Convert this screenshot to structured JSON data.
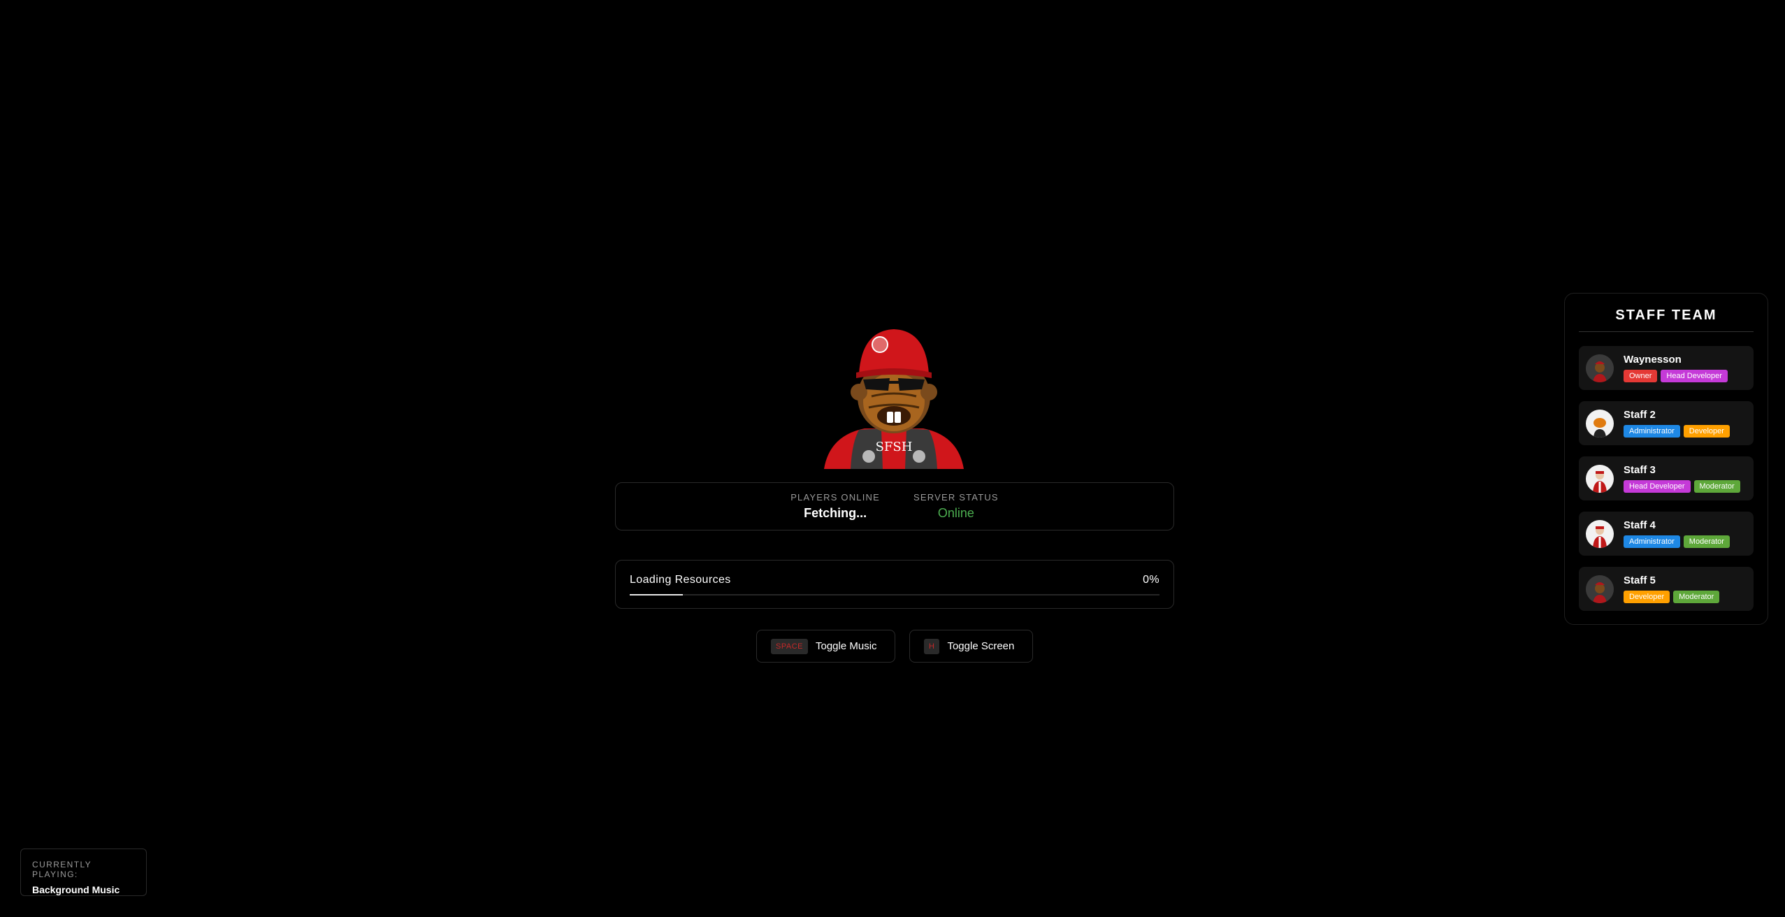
{
  "server": {
    "players_label": "PLAYERS ONLINE",
    "players_value": "Fetching...",
    "status_label": "SERVER STATUS",
    "status_value": "Online",
    "status_color": "#4caf50"
  },
  "logo": {
    "shirt_text": "SFSH",
    "description_icon": "beaver-character-logo"
  },
  "loading": {
    "label": "Loading Resources",
    "percent_text": "0%",
    "progress_fraction": 0.1
  },
  "controls": [
    {
      "key": "SPACE",
      "label": "Toggle Music"
    },
    {
      "key": "H",
      "label": "Toggle Screen"
    }
  ],
  "staff": {
    "title": "STAFF TEAM",
    "members": [
      {
        "name": "Waynesson",
        "avatar": "beaver-avatar",
        "badges": [
          {
            "text": "Owner",
            "color": "#e53935"
          },
          {
            "text": "Head Developer",
            "color": "#c53ad8"
          }
        ]
      },
      {
        "name": "Staff 2",
        "avatar": "pumpkin-avatar",
        "badges": [
          {
            "text": "Administrator",
            "color": "#1e88e5"
          },
          {
            "text": "Developer",
            "color": "#ffa000"
          }
        ]
      },
      {
        "name": "Staff 3",
        "avatar": "red-suit-avatar",
        "badges": [
          {
            "text": "Head Developer",
            "color": "#c53ad8"
          },
          {
            "text": "Moderator",
            "color": "#5ea83a"
          }
        ]
      },
      {
        "name": "Staff 4",
        "avatar": "red-suit-avatar",
        "badges": [
          {
            "text": "Administrator",
            "color": "#1e88e5"
          },
          {
            "text": "Moderator",
            "color": "#5ea83a"
          }
        ]
      },
      {
        "name": "Staff 5",
        "avatar": "beaver-avatar",
        "badges": [
          {
            "text": "Developer",
            "color": "#ffa000"
          },
          {
            "text": "Moderator",
            "color": "#5ea83a"
          }
        ]
      }
    ]
  },
  "now_playing": {
    "label": "CURRENTLY PLAYING:",
    "track": "Background Music"
  },
  "colors": {
    "background": "#000000",
    "accent_red": "#c62828",
    "card_border": "#2a2a2a"
  }
}
